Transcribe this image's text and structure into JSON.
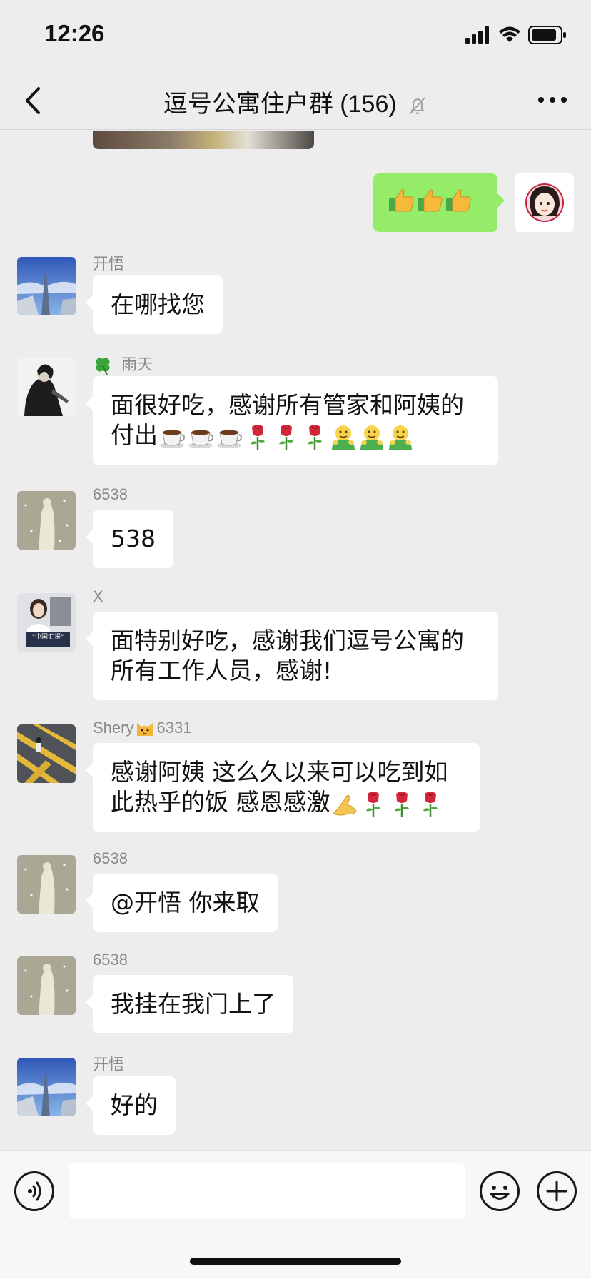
{
  "status_bar": {
    "time": "12:26"
  },
  "header": {
    "title": "逗号公寓住户群 (156)"
  },
  "messages": [
    {
      "sender": "开悟",
      "text": "在哪找您"
    },
    {
      "sender": "雨天",
      "line1": "面很好吃，感谢所有管家和阿姨的",
      "line2": "付出"
    },
    {
      "sender": "6538",
      "text": "538"
    },
    {
      "sender": "X",
      "line1": "面特别好吃，感谢我们逗号公寓的",
      "line2": "所有工作人员，感谢!"
    },
    {
      "sender_a": "Shery",
      "sender_b": "6331",
      "line1": "感谢阿姨 这么久以来可以吃到如",
      "line2": "此热乎的饭 感恩感激"
    },
    {
      "sender": "6538",
      "text": "@开悟 你来取"
    },
    {
      "sender": "6538",
      "text": "我挂在我门上了"
    },
    {
      "sender": "开悟",
      "text": "好的"
    }
  ],
  "avatar_x_caption": "\"中国汇报\"",
  "icons": {
    "back": "chevron-left-icon",
    "mute": "bell-slash-icon",
    "more": "more-dots-icon",
    "voice": "voice-icon",
    "emoji": "emoji-icon",
    "add": "plus-icon",
    "clover": "clover-icon",
    "thumbs": "thumbs-up-icon",
    "coffee": "coffee-icon",
    "rose": "rose-icon",
    "hug": "hug-icon",
    "cat": "cat-icon",
    "pray": "praying-hands-icon"
  },
  "colors": {
    "background": "#ededed",
    "self_bubble": "#95ec69",
    "other_bubble": "#ffffff",
    "sender_name": "#8a8a8a"
  }
}
